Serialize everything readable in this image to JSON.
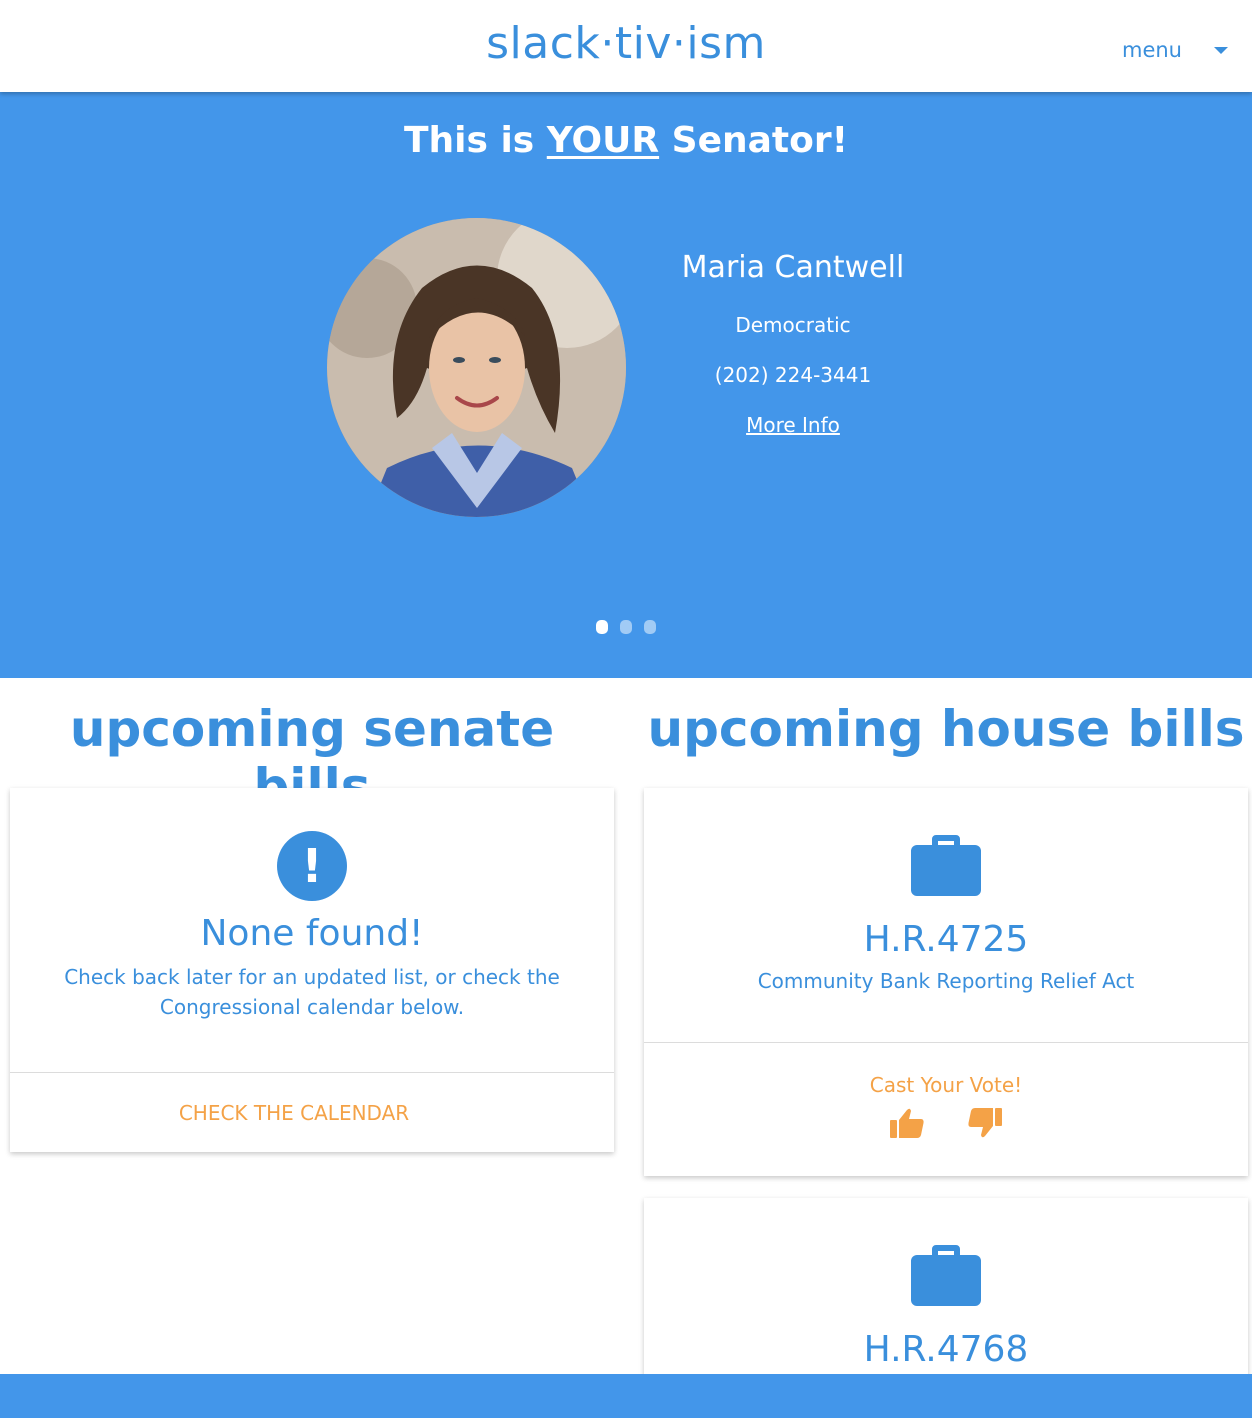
{
  "brand": "slack·tiv·ism",
  "menu": {
    "label": "menu"
  },
  "hero": {
    "title_prefix": "This is ",
    "title_emphasis": "YOUR",
    "title_suffix": " Senator!",
    "senator": {
      "name": "Maria Cantwell",
      "party": "Democratic",
      "phone": "(202) 224-3441",
      "more_info": "More Info"
    },
    "carousel": {
      "count": 3,
      "active_index": 0
    }
  },
  "senate": {
    "heading": "upcoming senate bills",
    "empty": {
      "title": "None found!",
      "message": "Check back later for an updated list, or check the Congressional calendar below.",
      "action": "CHECK THE CALENDAR"
    }
  },
  "house": {
    "heading": "upcoming house bills",
    "bills": [
      {
        "number": "H.R.4725",
        "title": "Community Bank Reporting Relief Act",
        "vote_label": "Cast Your Vote!"
      },
      {
        "number": "H.R.4768"
      }
    ]
  },
  "colors": {
    "primary": "#3a8fdc",
    "hero_bg": "#4396ea",
    "accent": "#f4a247"
  },
  "icons": {
    "menu_caret": "caret-down-icon",
    "empty_state": "exclamation-circle-icon",
    "bill": "briefcase-icon",
    "upvote": "thumbs-up-icon",
    "downvote": "thumbs-down-icon"
  }
}
